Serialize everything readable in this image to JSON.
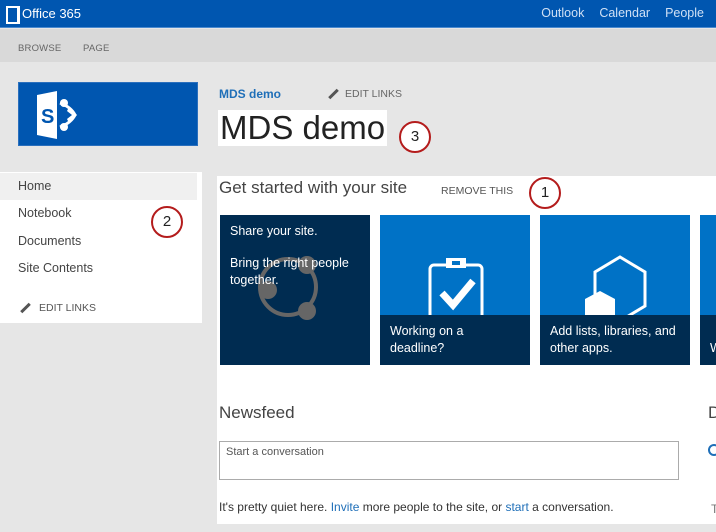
{
  "suite_bar": {
    "brand": "Office 365",
    "links": [
      "Outlook",
      "Calendar",
      "People"
    ],
    "color": "#0056b0"
  },
  "ribbon": {
    "tabs": [
      "BROWSE",
      "PAGE"
    ]
  },
  "header": {
    "breadcrumb_title": "MDS demo",
    "edit_links": "EDIT LINKS",
    "site_title": "MDS demo",
    "logo_letter": "S"
  },
  "left_nav": {
    "items": [
      {
        "label": "Home",
        "active": true
      },
      {
        "label": "Notebook",
        "active": false
      },
      {
        "label": "Documents",
        "active": false
      },
      {
        "label": "Site Contents",
        "active": false
      }
    ],
    "edit_links": "EDIT LINKS"
  },
  "get_started": {
    "title": "Get started with your site",
    "remove_label": "REMOVE THIS",
    "tiles": [
      {
        "line1": "Share your site.",
        "line2": "Bring the right people together.",
        "icon": "share-icon"
      },
      {
        "text": "Working on a deadline?",
        "icon": "clipboard-check-icon"
      },
      {
        "text": "Add lists, libraries, and other apps.",
        "icon": "apps-hexagon-icon"
      },
      {
        "text": "W",
        "icon": ""
      }
    ]
  },
  "newsfeed": {
    "title": "Newsfeed",
    "input_placeholder": "Start a conversation",
    "quiet_prefix": "It's pretty quiet here. ",
    "invite_link": "Invite",
    "quiet_middle": " more people to the site, or ",
    "start_link": "start",
    "quiet_suffix": " a conversation."
  },
  "right_column": {
    "title_partial": "D",
    "text_partial": "T"
  },
  "callouts": [
    "1",
    "2",
    "3"
  ],
  "colors": {
    "tile_dark": "#002c51",
    "tile_blue": "#0072c6",
    "link": "#1f6fb8",
    "callout_ring": "#b41c1c"
  }
}
